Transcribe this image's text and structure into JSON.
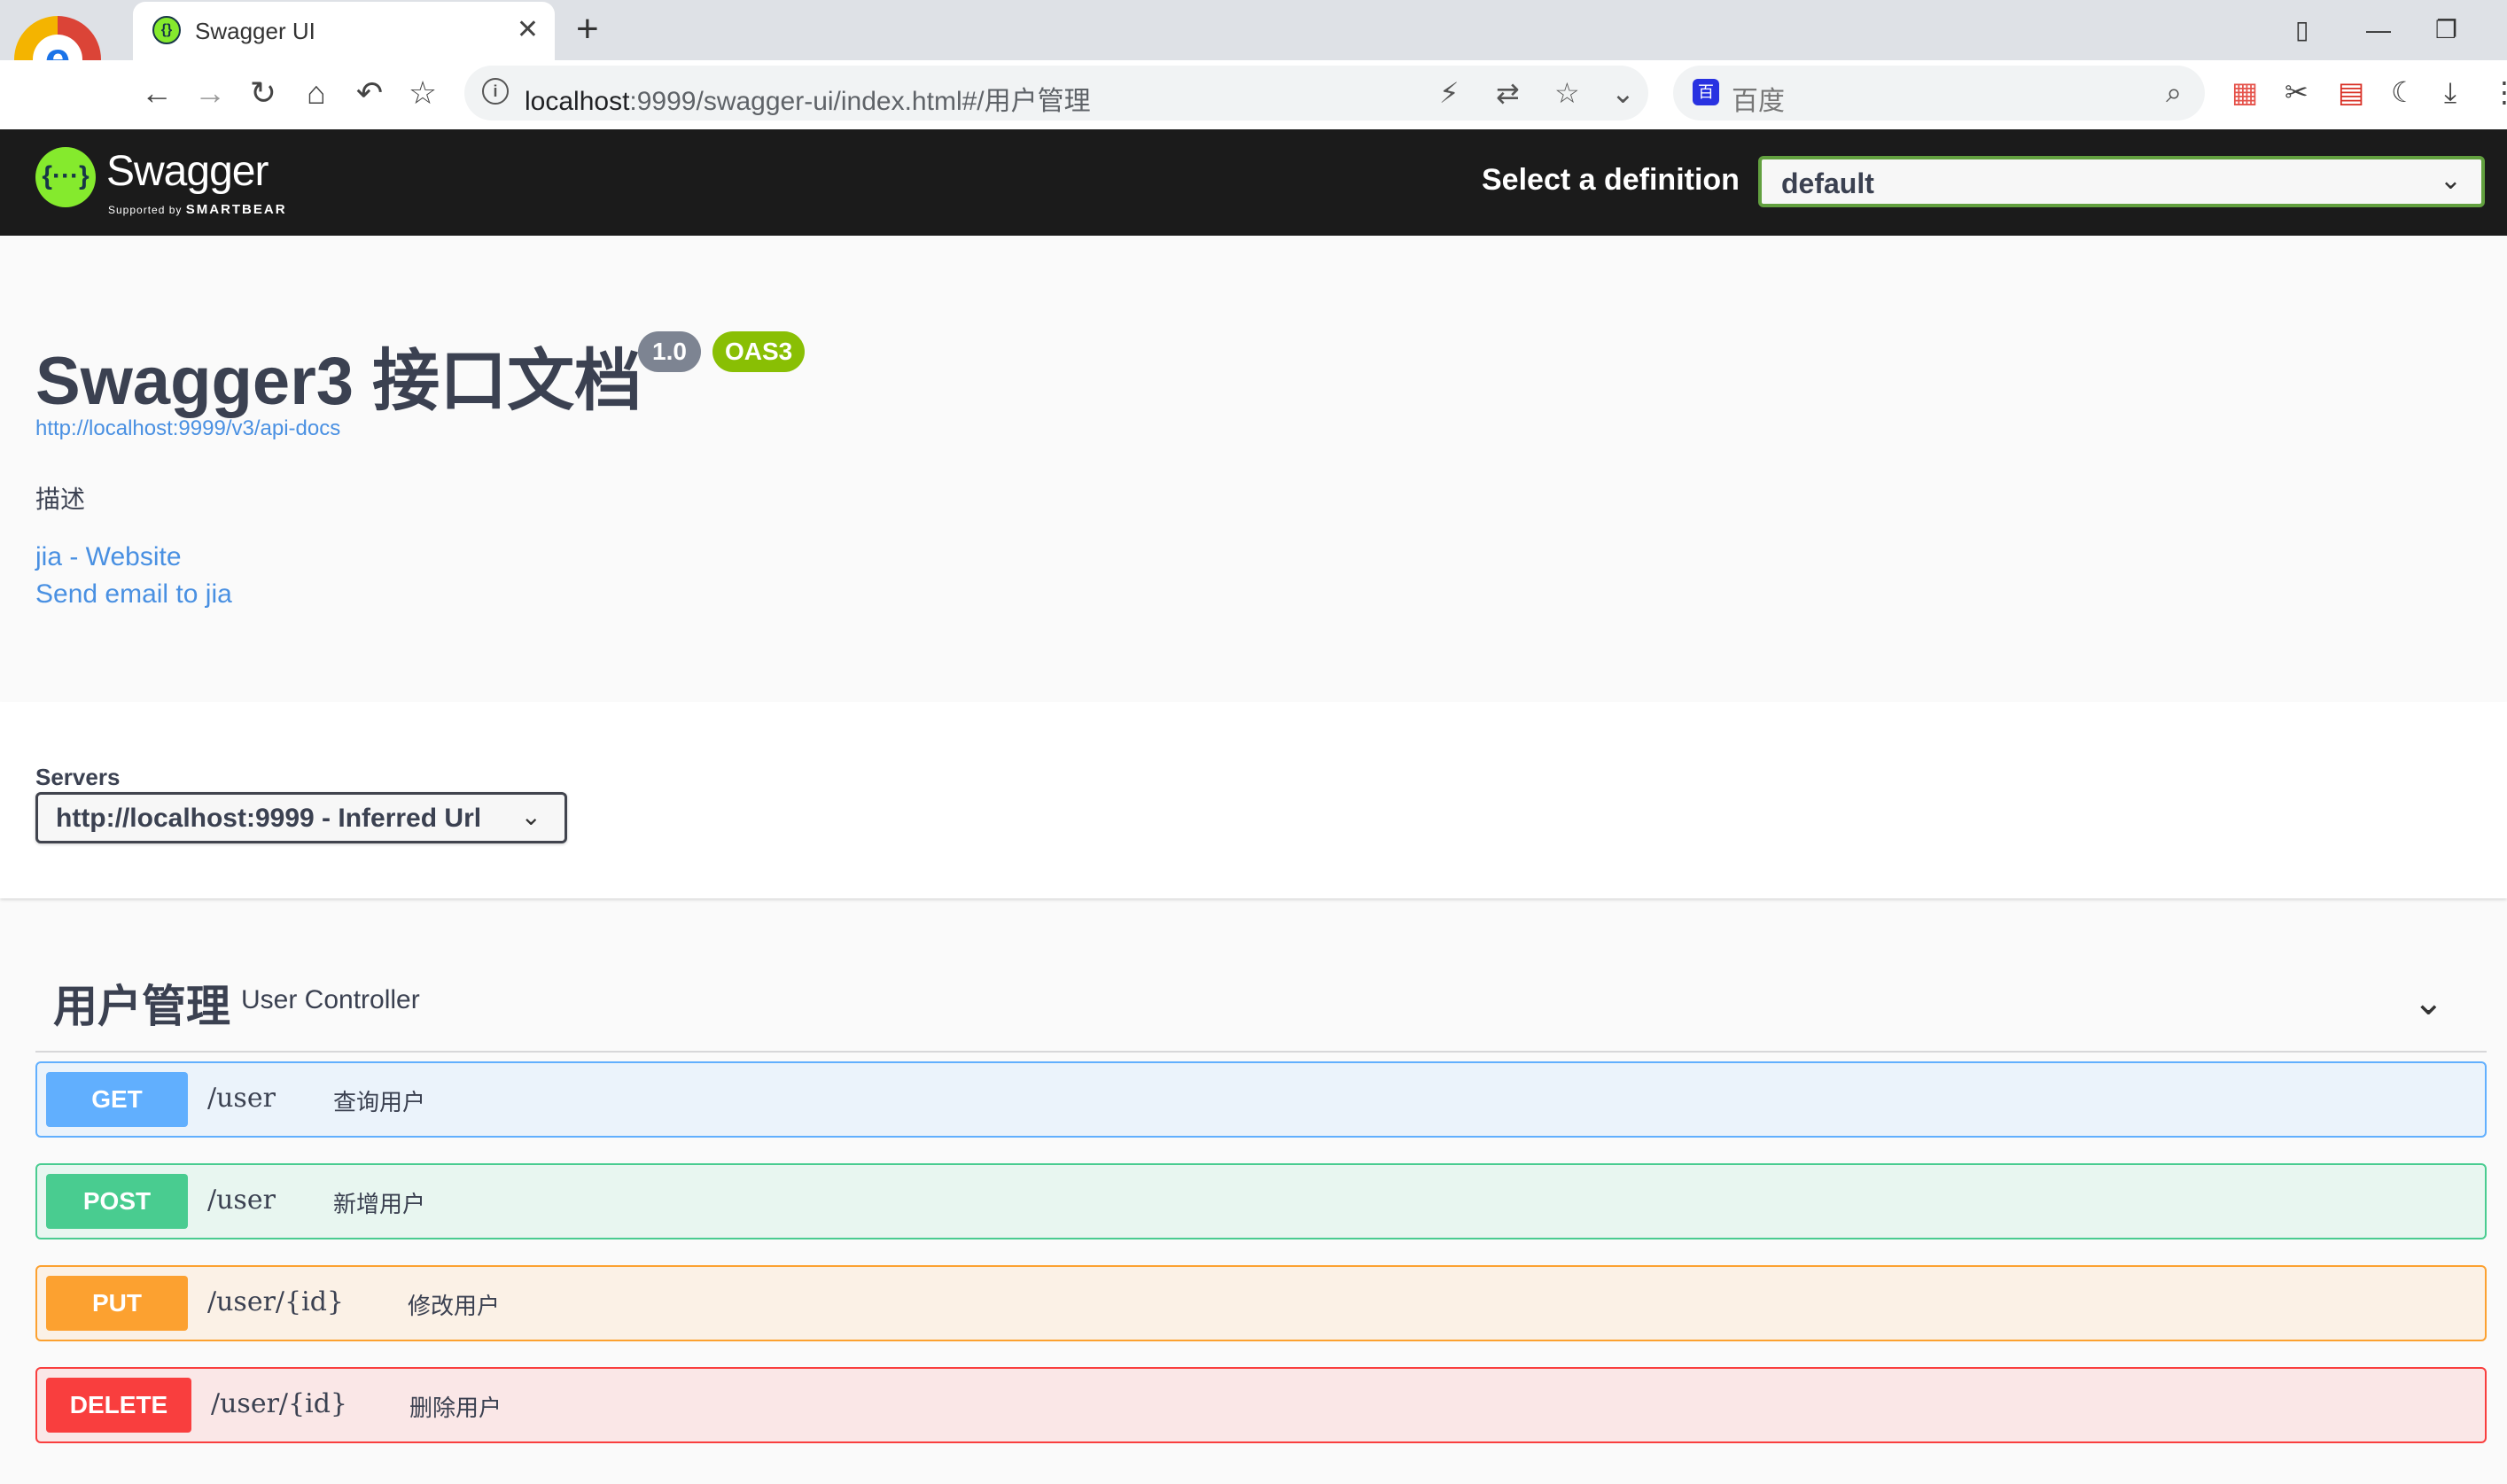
{
  "browser": {
    "tab_title": "Swagger UI",
    "url_host": "localhost",
    "url_rest": ":9999/swagger-ui/index.html#/用户管理",
    "search_placeholder": "百度"
  },
  "topbar": {
    "brand": "Swagger",
    "supported_by": "Supported by",
    "smartbear": "SMARTBEAR",
    "select_label": "Select a definition",
    "selected_definition": "default"
  },
  "info": {
    "title": "Swagger3 接口文档",
    "version": "1.0",
    "oas": "OAS3",
    "docs_url": "http://localhost:9999/v3/api-docs",
    "description": "描述",
    "website_link": "jia - Website",
    "email_link": "Send email to jia"
  },
  "servers": {
    "label": "Servers",
    "selected": "http://localhost:9999 - Inferred Url"
  },
  "tag": {
    "name": "用户管理",
    "description": "User Controller"
  },
  "operations": [
    {
      "method": "GET",
      "path": "/user",
      "summary": "查询用户"
    },
    {
      "method": "POST",
      "path": "/user",
      "summary": "新增用户"
    },
    {
      "method": "PUT",
      "path": "/user/{id}",
      "summary": "修改用户"
    },
    {
      "method": "DELETE",
      "path": "/user/{id}",
      "summary": "删除用户"
    }
  ],
  "colors": {
    "get": "#61affe",
    "post": "#49cc90",
    "put": "#fca130",
    "delete": "#f93e3e",
    "swagger_green": "#85ea2d",
    "link": "#4990e2"
  }
}
